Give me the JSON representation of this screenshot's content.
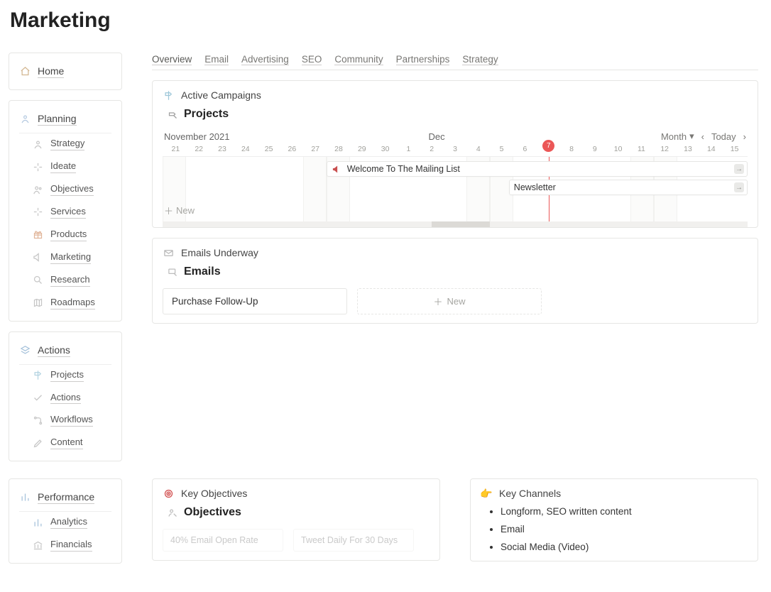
{
  "page": {
    "title": "Marketing"
  },
  "sidebar": {
    "home": {
      "label": "Home"
    },
    "planning": {
      "label": "Planning",
      "items": [
        {
          "label": "Strategy",
          "icon": "person-icon"
        },
        {
          "label": "Ideate",
          "icon": "sparkle-icon"
        },
        {
          "label": "Objectives",
          "icon": "people-icon"
        },
        {
          "label": "Services",
          "icon": "sparkle-icon"
        },
        {
          "label": "Products",
          "icon": "gift-icon"
        },
        {
          "label": "Marketing",
          "icon": "megaphone-icon"
        },
        {
          "label": "Research",
          "icon": "search-icon"
        },
        {
          "label": "Roadmaps",
          "icon": "map-icon"
        }
      ]
    },
    "actions": {
      "label": "Actions",
      "items": [
        {
          "label": "Projects",
          "icon": "signpost-icon"
        },
        {
          "label": "Actions",
          "icon": "check-icon"
        },
        {
          "label": "Workflows",
          "icon": "flow-icon"
        },
        {
          "label": "Content",
          "icon": "pencil-icon"
        }
      ]
    },
    "performance": {
      "label": "Performance",
      "items": [
        {
          "label": "Analytics",
          "icon": "bars-icon"
        },
        {
          "label": "Financials",
          "icon": "bank-icon"
        }
      ]
    }
  },
  "tabs": [
    "Overview",
    "Email",
    "Advertising",
    "SEO",
    "Community",
    "Partnerships",
    "Strategy"
  ],
  "campaigns": {
    "title": "Active Campaigns",
    "projects_heading": "Projects",
    "month_label_left": "November 2021",
    "month_label_mid": "Dec",
    "controls": {
      "granularity": "Month",
      "today": "Today"
    },
    "days": [
      "21",
      "22",
      "23",
      "24",
      "25",
      "26",
      "27",
      "28",
      "29",
      "30",
      "1",
      "2",
      "3",
      "4",
      "5",
      "6",
      "7",
      "8",
      "9",
      "10",
      "11",
      "12",
      "13",
      "14",
      "15"
    ],
    "today_index": 16,
    "events": [
      {
        "label": "Welcome To The Mailing List",
        "icon": "megaphone-red-icon"
      },
      {
        "label": "Newsletter"
      }
    ],
    "new_label": "New"
  },
  "emails": {
    "title": "Emails Underway",
    "heading": "Emails",
    "items": [
      "Purchase Follow-Up"
    ],
    "new_label": "New"
  },
  "objectives": {
    "title": "Key Objectives",
    "heading": "Objectives",
    "items": [
      "40% Email Open Rate",
      "Tweet Daily For 30 Days"
    ]
  },
  "channels": {
    "title": "Key Channels",
    "items": [
      "Longform, SEO written content",
      "Email",
      "Social Media (Video)"
    ]
  }
}
